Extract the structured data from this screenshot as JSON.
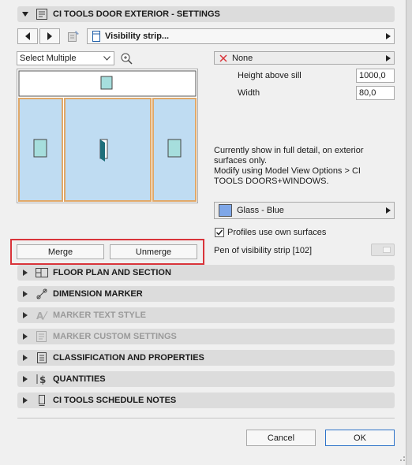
{
  "header": {
    "title": "CI TOOLS DOOR EXTERIOR - SETTINGS"
  },
  "toolbar": {
    "strip_label": "Visibility strip..."
  },
  "preview": {
    "select_value": "Select Multiple"
  },
  "fill": {
    "none_label": "None"
  },
  "dimensions": {
    "height_label": "Height above sill",
    "height_value": "1000,0",
    "width_label": "Width",
    "width_value": "80,0"
  },
  "info": {
    "line1": "Currently show in full detail, on exterior",
    "line2": "surfaces only.",
    "line3": "Modify using Model View Options > CI",
    "line4": "TOOLS DOORS+WINDOWS."
  },
  "material": {
    "label": "Glass - Blue",
    "color": "#7fa7e8"
  },
  "profiles": {
    "label": "Profiles use own surfaces",
    "checked": true
  },
  "pen": {
    "label": "Pen of visibility strip [102]"
  },
  "merge": {
    "merge_label": "Merge",
    "unmerge_label": "Unmerge"
  },
  "sections": [
    {
      "label": "FLOOR PLAN AND SECTION"
    },
    {
      "label": "DIMENSION MARKER"
    },
    {
      "label": "MARKER TEXT STYLE"
    },
    {
      "label": "MARKER CUSTOM SETTINGS"
    },
    {
      "label": "CLASSIFICATION AND PROPERTIES"
    },
    {
      "label": "QUANTITIES"
    },
    {
      "label": "CI TOOLS SCHEDULE NOTES"
    }
  ],
  "footer": {
    "cancel_label": "Cancel",
    "ok_label": "OK"
  },
  "colors": {
    "highlight": "#d9343a",
    "pane_fill": "#bfdcf2",
    "pane_border": "#e0a868",
    "panel_icon": "#a6dedd",
    "handle": "#1f6f7a"
  }
}
